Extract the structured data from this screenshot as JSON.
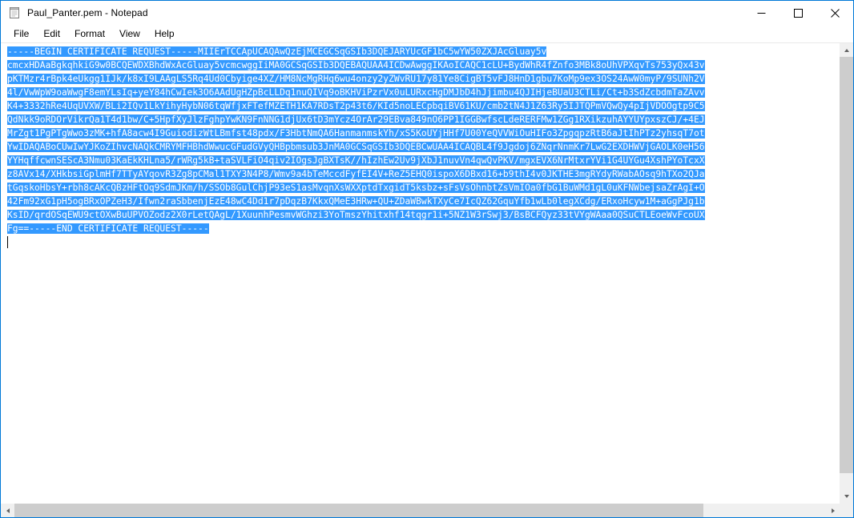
{
  "window": {
    "title": "Paul_Panter.pem - Notepad",
    "icon": "notepad-icon",
    "controls": {
      "minimize_label": "Minimize",
      "maximize_label": "Maximize",
      "close_label": "Close"
    }
  },
  "menubar": {
    "items": [
      {
        "label": "File"
      },
      {
        "label": "Edit"
      },
      {
        "label": "Format"
      },
      {
        "label": "View"
      },
      {
        "label": "Help"
      }
    ]
  },
  "editor": {
    "selected": true,
    "lines": [
      "-----BEGIN CERTIFICATE REQUEST-----MIIErTCCApUCAQAwQzEjMCEGCSqGSIb3DQEJARYUcGF1bC5wYW50ZXJAcGluay5v",
      "cmcxHDAaBgkqhkiG9w0BCQEWDXBhdWxAcGluay5vcmcwggIiMA0GCSqGSIb3DQEBAQUAA4ICDwAwggIKAoICAQC1cLU+BydWhR4fZnfo3MBk8oUhVPXqvTs753yQx43v",
      "pKTMzr4rBpk4eUkgg1IJk/k8xI9LAAgLS5Rq4Ud0Cbyige4XZ/HM8NcMgRHq6wu4onzy2yZWvRU17y81Ye8CigBT5vFJ8HnD1gbu7KoMp9ex3OS24AwW0myP/9SUNh2V",
      "4l/VwWpW9oaWwgF8emYLsIq+yeY84hCwIek3O6AAdUgHZpBcLLDq1nuQIVq9oBKHViPzrVx0uLURxcHgDMJbD4hJjimbu4QJIHjeBUaU3CTLi/Ct+b3SdZcbdmTaZAvv",
      "K4+3332hRe4UqUVXW/BLi2IQv1LkYihyHybN06tqWfjxFTefMZETH1KA7RDsT2p43t6/KId5noLECpbqiBV61KU/cmb2tN4J1Z63Ry5IJTQPmVQwQy4pIjVDOOgtp9C5",
      "QdNkk9oRDOrVikrQa1T4d1bw/C+5HpfXyJlzFghpYwKN9FnNNG1djUx6tD3mYcz4OrAr29EBva849nO6PP1IGGBwfscLdeRERFMw1ZGg1RXikzuhAYYUYpxszCJ/+4EJ",
      "MrZgt1PgPTgWwo3zMK+hfA8acw4I9GuiodizWtLBmfst48pdx/F3HbtNmQA6HanmanmskYh/xS5KoUYjHHf7U00YeQVVWiOuHIFo3ZpgqpzRtB6aJtIhPTz2yhsqT7ot",
      "YwIDAQABoCUwIwYJKoZIhvcNAQkCMRYMFHBhdWwucGFudGVyQHBpbmsub3JnMA0GCSqGSIb3DQEBCwUAA4ICAQBL4f9Jgdoj6ZNqrNnmKr7LwG2EXDHWVjGAOLK0eH56",
      "YYHqffcwnSEScA3Nmu03KaEkKHLna5/rWRg5kB+taSVLFiO4qiv2IOgsJgBXTsK//hIzhEw2Uv9jXbJ1nuvVn4qwQvPKV/mgxEVX6NrMtxrYVi1G4UYGu4XshPYoTcxX",
      "z8AVx14/XHkbsiGplmHf7TTyAYqovR3Zg8pCMal1TXY3N4P8/Wmv9a4bTeMccdFyfEI4V+ReZ5EHQ0ispoX6DBxd16+b9thI4v0JKTHE3mgRYdyRWabAOsq9hTXo2QJa",
      "tGqskoHbsY+rbh8cAKcQBzHFtOq9SdmJKm/h/SSOb8GulChjP93eS1asMvqnXsWXXptdTxgidT5ksbz+sFsVsOhnbtZsVmIOa0fbG1BuWMd1gL0uKFNWbejsaZrAgI+O",
      "42Fm92xG1pH5ogBRxOPZeH3/Ifwn2raSbbenjEzE48wC4Dd1r7pDqzB7KkxQMeE3HRw+QU+ZDaWBwkTXyCe7IcQZ62GquYfb1wLb0legXCdg/ERxoHcyw1M+aGgPJg1b",
      "KsID/qrdOSqEWU9ctOXwBuUPVOZodz2X0rLetQAgL/1XuunhPesmvWGhzi3YoTmszYhitxhf14tqgr1i+5NZ1W3rSwj3/BsBCFQyz33tVYgWAaa0QSuCTLEoeWvFcoUX",
      "Fg==-----END CERTIFICATE REQUEST-----"
    ],
    "selection_color": "#3399ff",
    "selection_text_color": "#ffffff"
  },
  "scrollbars": {
    "vertical_position": "top",
    "horizontal_position": "left"
  },
  "colors": {
    "window_border": "#0078d7",
    "scrollbar_track": "#f0f0f0",
    "scrollbar_thumb": "#cdcdcd"
  }
}
